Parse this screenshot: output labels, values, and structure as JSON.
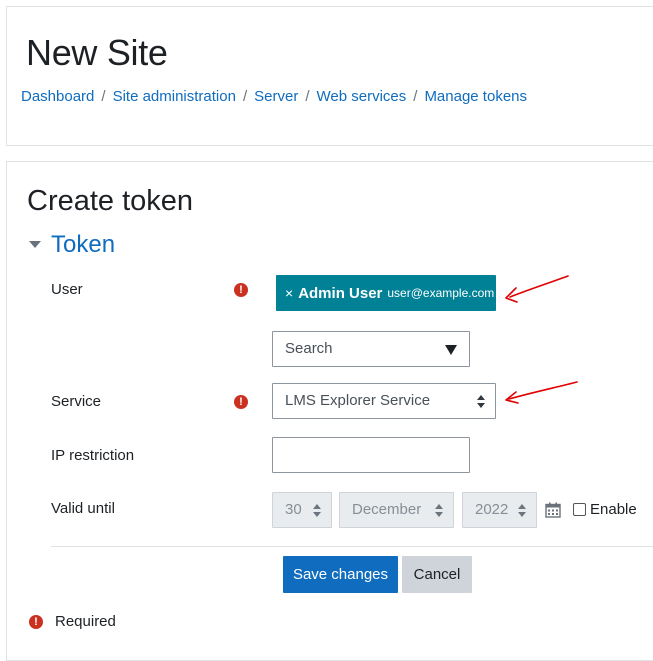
{
  "header": {
    "site_title": "New Site",
    "breadcrumb": [
      "Dashboard",
      "Site administration",
      "Server",
      "Web services",
      "Manage tokens"
    ],
    "separator": "/"
  },
  "form": {
    "heading": "Create token",
    "section_title": "Token",
    "required_mark": "!",
    "user": {
      "label": "User",
      "selected_remove": "×",
      "selected_name": "Admin User",
      "selected_email": "user@example.com",
      "search_placeholder": "Search"
    },
    "service": {
      "label": "Service",
      "value": "LMS Explorer Service"
    },
    "ip_restriction": {
      "label": "IP restriction",
      "value": ""
    },
    "valid_until": {
      "label": "Valid until",
      "day": "30",
      "month": "December",
      "year": "2022",
      "enable_label": "Enable",
      "enabled": false
    },
    "buttons": {
      "save": "Save changes",
      "cancel": "Cancel"
    },
    "required_note": "Required"
  },
  "colors": {
    "link": "#0f6cbf",
    "required_icon": "#ca3120",
    "chip": "#008196",
    "primary_button": "#0f6cbf",
    "annotation_arrow": "#e00000"
  },
  "icons": [
    "collapse-caret-icon",
    "required-icon",
    "dropdown-caret-icon",
    "updown-select-icon",
    "calendar-icon"
  ]
}
